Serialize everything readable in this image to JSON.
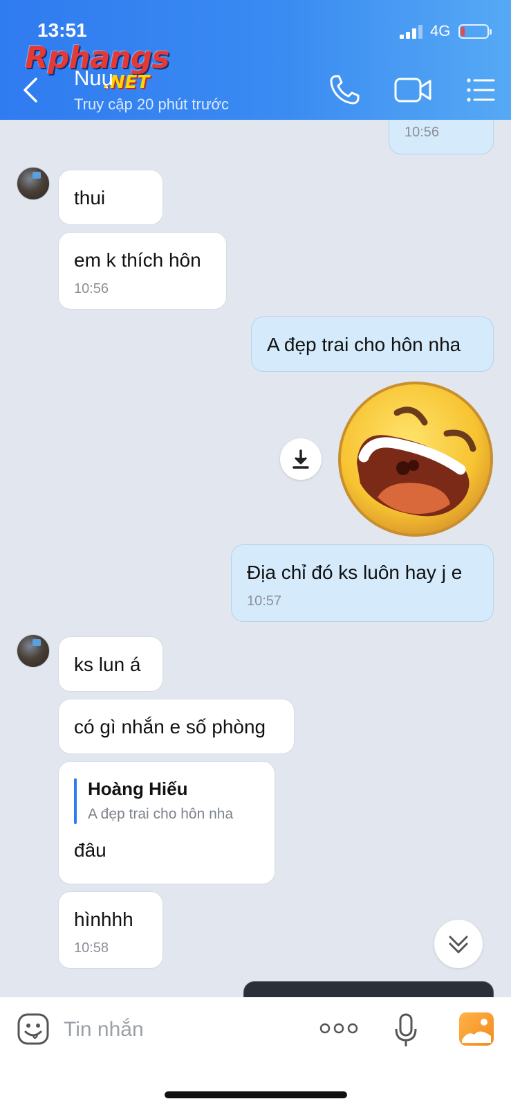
{
  "status_bar": {
    "time": "13:51",
    "network": "4G",
    "battery_level": "low"
  },
  "watermark": {
    "main": "Rphangs",
    "sub": ".NET"
  },
  "header": {
    "contact_name": "Nuụ",
    "last_seen": "Truy cập 20 phút trước",
    "icons": [
      "back-icon",
      "phone-icon",
      "video-camera-icon",
      "menu-list-icon"
    ],
    "background": "#3a8bf2"
  },
  "messages": [
    {
      "side": "out",
      "time": "10:56"
    },
    {
      "side": "in",
      "text": "thui"
    },
    {
      "side": "in",
      "text": "em k thích hôn",
      "time": "10:56"
    },
    {
      "side": "out",
      "text": "A đẹp trai cho hôn nha"
    },
    {
      "side": "out",
      "type": "sticker",
      "sticker": "laughing-face-icon"
    },
    {
      "side": "out",
      "text": "Địa chỉ đó ks luôn hay j e",
      "time": "10:57"
    },
    {
      "side": "in",
      "text": "ks lun á"
    },
    {
      "side": "in",
      "text": "có gì nhắn e số phòng"
    },
    {
      "side": "in",
      "quote": {
        "name": "Hoàng Hiếu",
        "text": "A đẹp trai cho hôn nha"
      },
      "text": "đâu"
    },
    {
      "side": "in",
      "text": "hìnhhh",
      "time": "10:58"
    },
    {
      "side": "out",
      "type": "image"
    }
  ],
  "input_bar": {
    "placeholder": "Tin nhắn",
    "icons": [
      "emoji-icon",
      "more-icon",
      "microphone-icon",
      "gallery-icon"
    ]
  },
  "colors": {
    "incoming_bubble": "#ffffff",
    "outgoing_bubble": "#d5ebfc",
    "chat_background": "#e2e6ee",
    "accent": "#2f7bf0"
  }
}
